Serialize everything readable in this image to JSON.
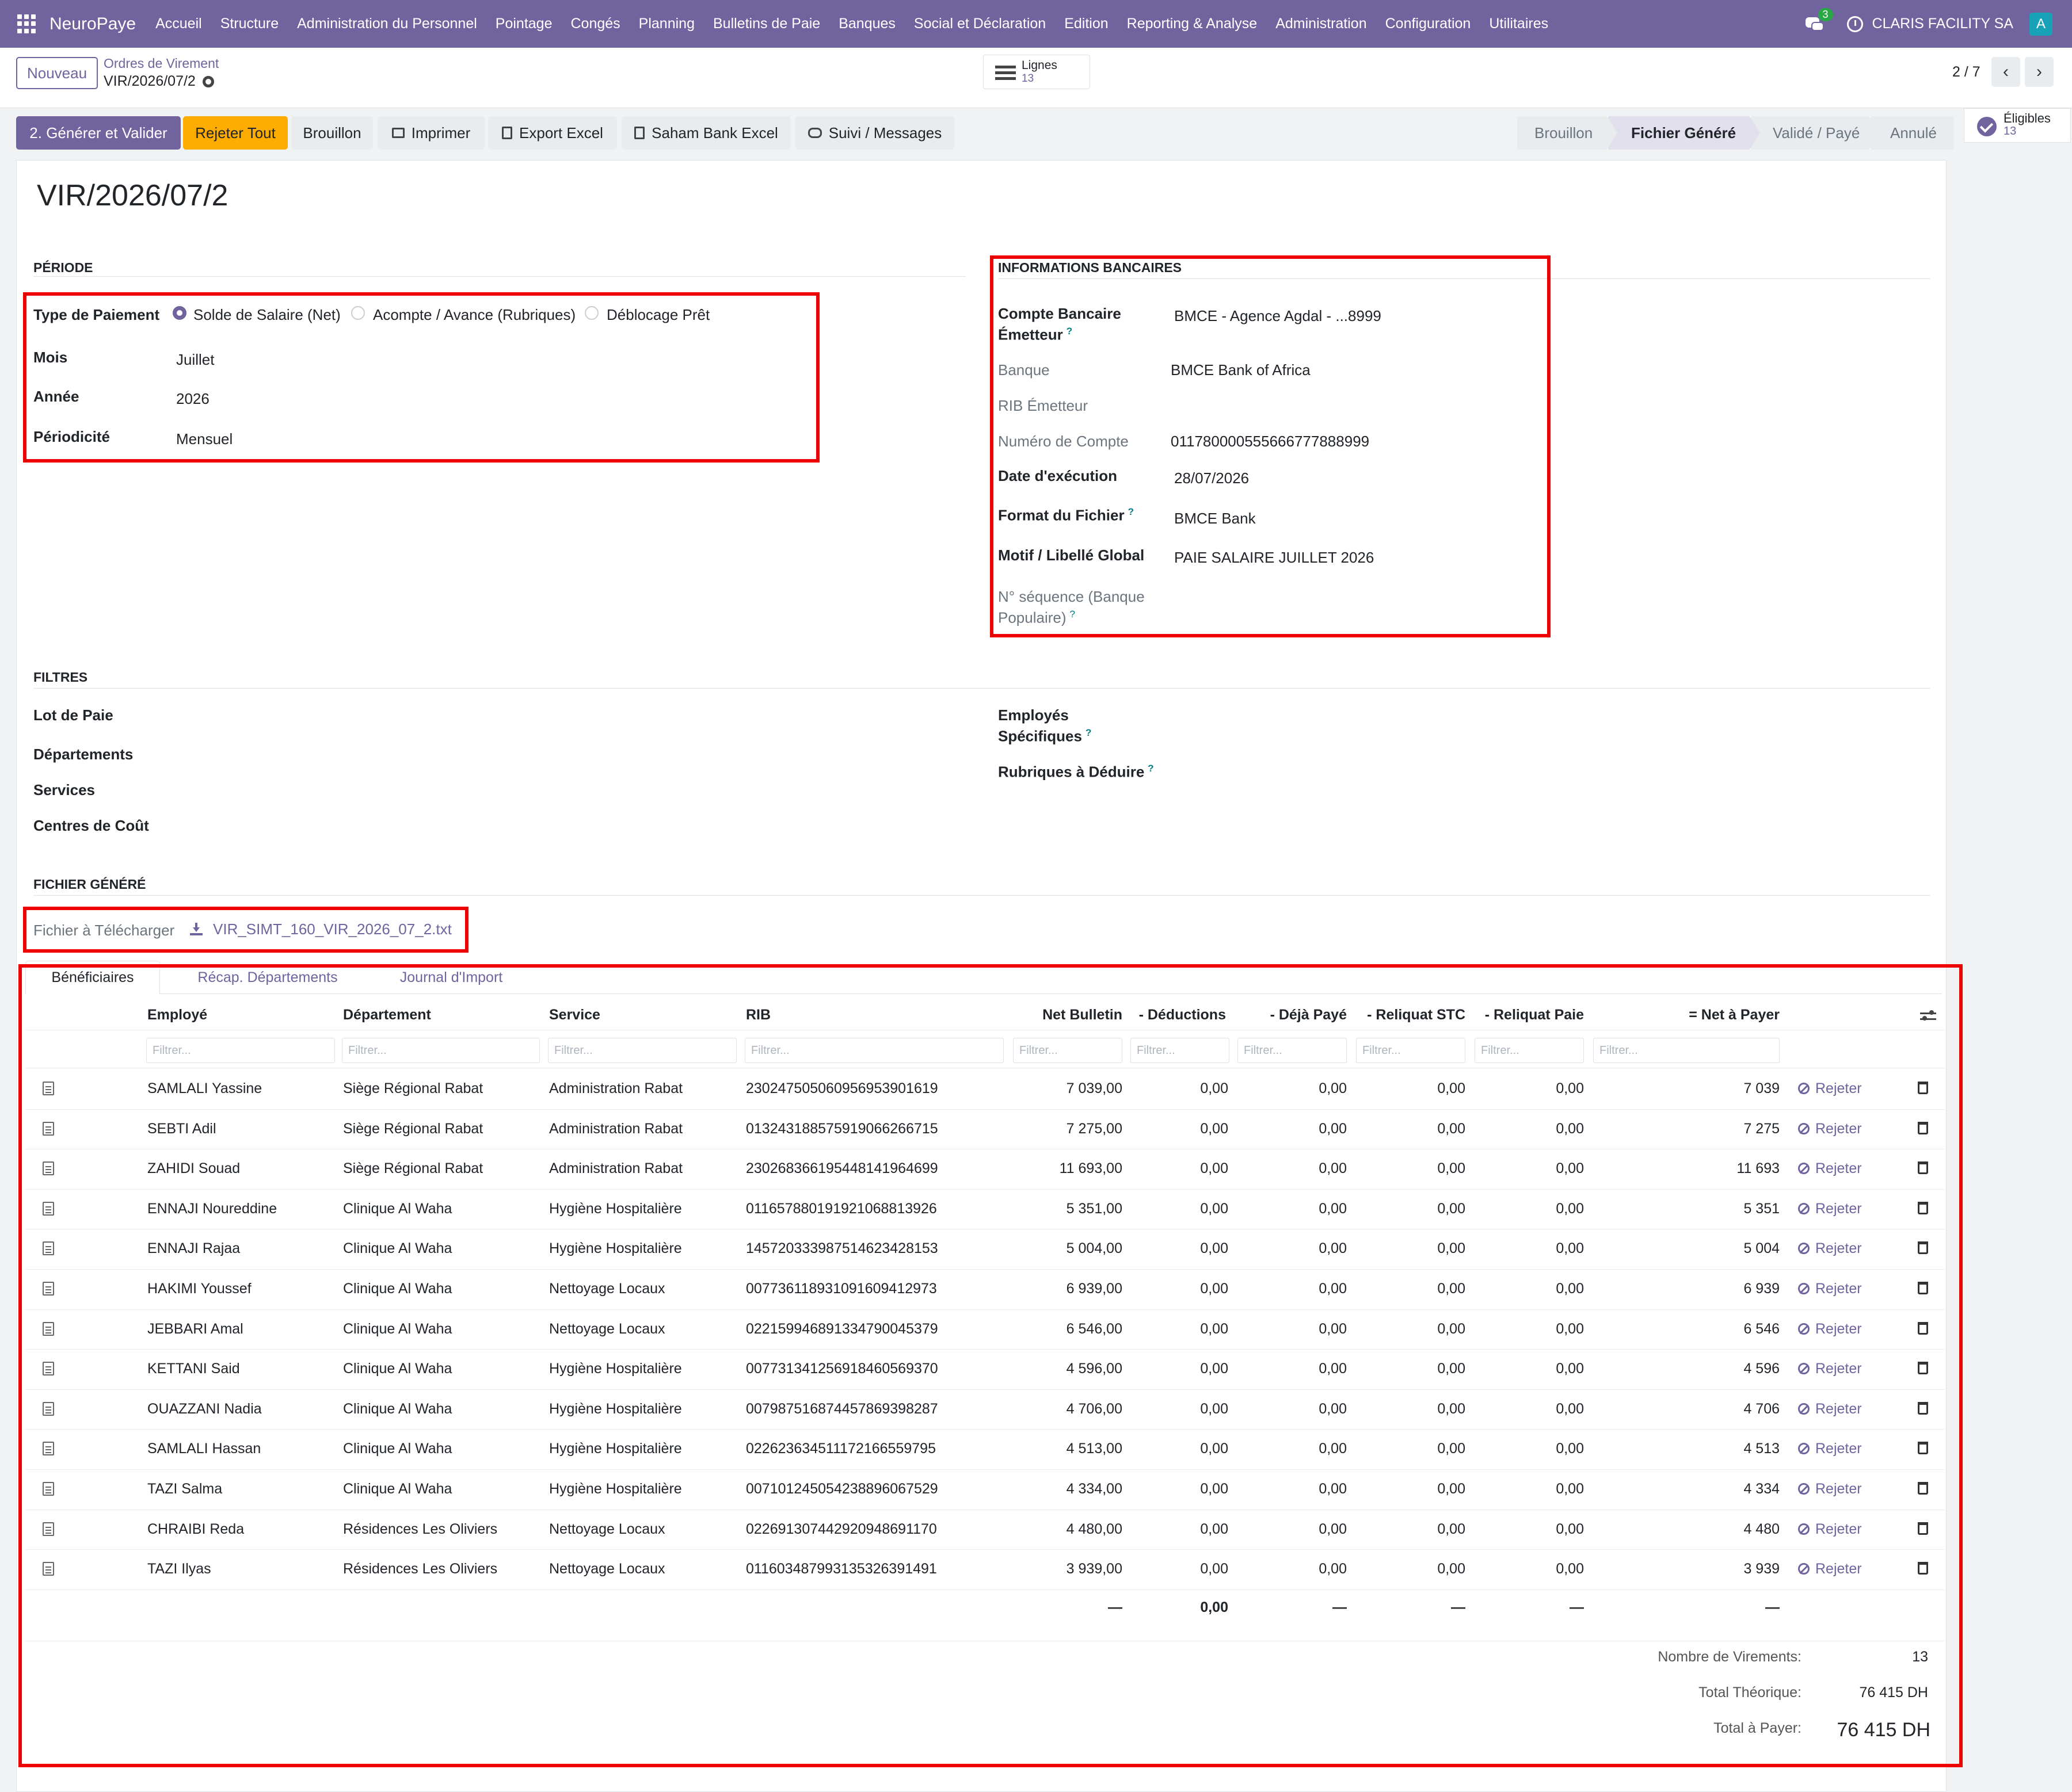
{
  "app": {
    "brand": "NeuroPaye",
    "menu": [
      "Accueil",
      "Structure",
      "Administration du Personnel",
      "Pointage",
      "Congés",
      "Planning",
      "Bulletins de Paie",
      "Banques",
      "Social et Déclaration",
      "Edition",
      "Reporting & Analyse",
      "Administration",
      "Configuration",
      "Utilitaires"
    ],
    "chat_badge": "3",
    "company": "CLARIS FACILITY SA",
    "avatar": "A"
  },
  "control": {
    "new_button": "Nouveau",
    "breadcrumb_parent": "Ordres de Virement",
    "breadcrumb_current": "VIR/2026/07/2",
    "lines_label": "Lignes",
    "lines_count": "13",
    "pager": "2 / 7"
  },
  "actions": {
    "generate": "2. Générer et Valider",
    "reject_all": "Rejeter Tout",
    "draft": "Brouillon",
    "print": "Imprimer",
    "export_excel": "Export Excel",
    "saham": "Saham Bank Excel",
    "followup": "Suivi / Messages"
  },
  "status": {
    "stages": [
      "Brouillon",
      "Fichier Généré",
      "Validé / Payé",
      "Annulé"
    ],
    "active": "Fichier Généré"
  },
  "side": {
    "label": "Éligibles",
    "count": "13"
  },
  "record": {
    "title": "VIR/2026/07/2",
    "periode": {
      "section": "PÉRIODE",
      "type_label": "Type de Paiement",
      "type_options": [
        "Solde de Salaire (Net)",
        "Acompte / Avance (Rubriques)",
        "Déblocage Prêt"
      ],
      "type_selected": "Solde de Salaire (Net)",
      "mois_label": "Mois",
      "mois": "Juillet",
      "annee_label": "Année",
      "annee": "2026",
      "periodicite_label": "Périodicité",
      "periodicite": "Mensuel"
    },
    "bank": {
      "section": "INFORMATIONS BANCAIRES",
      "compte_label_1": "Compte Bancaire",
      "compte_label_2": "Émetteur",
      "compte": "BMCE - Agence Agdal - ...8999",
      "banque_label": "Banque",
      "banque": "BMCE Bank of Africa",
      "rib_label": "RIB Émetteur",
      "numero_label": "Numéro de Compte",
      "numero": "011780000555666777888999",
      "date_label": "Date d'exécution",
      "date": "28/07/2026",
      "format_label": "Format du Fichier",
      "format": "BMCE Bank",
      "motif_label": "Motif / Libellé Global",
      "motif": "PAIE SALAIRE JUILLET 2026",
      "sequence_label_1": "N° séquence (Banque",
      "sequence_label_2": "Populaire)"
    },
    "filtres": {
      "section": "FILTRES",
      "lot": "Lot de Paie",
      "departements": "Départements",
      "services": "Services",
      "centres": "Centres de Coût",
      "employes_1": "Employés",
      "employes_2": "Spécifiques",
      "rubriques": "Rubriques à Déduire"
    },
    "fichier": {
      "section": "FICHIER GÉNÉRÉ",
      "label": "Fichier à Télécharger",
      "filename": "VIR_SIMT_160_VIR_2026_07_2.txt"
    }
  },
  "tabs": [
    "Bénéficiaires",
    "Récap. Départements",
    "Journal d'Import"
  ],
  "table": {
    "headers": [
      "Employé",
      "Département",
      "Service",
      "RIB",
      "Net Bulletin",
      "- Déductions",
      "- Déjà Payé",
      "- Reliquat STC",
      "- Reliquat Paie",
      "= Net à Payer"
    ],
    "filter_placeholder": "Filtrer...",
    "reject_label": "Rejeter",
    "rows": [
      {
        "employe": "SAMLALI Yassine",
        "departement": "Siège Régional Rabat",
        "service": "Administration Rabat",
        "rib": "230247505060956953901619",
        "net": "7 039,00",
        "ded": "0,00",
        "paye": "0,00",
        "stc": "0,00",
        "paie": "0,00",
        "apayer": "7 039"
      },
      {
        "employe": "SEBTI Adil",
        "departement": "Siège Régional Rabat",
        "service": "Administration Rabat",
        "rib": "013243188575919066266715",
        "net": "7 275,00",
        "ded": "0,00",
        "paye": "0,00",
        "stc": "0,00",
        "paie": "0,00",
        "apayer": "7 275"
      },
      {
        "employe": "ZAHIDI Souad",
        "departement": "Siège Régional Rabat",
        "service": "Administration Rabat",
        "rib": "230268366195448141964699",
        "net": "11 693,00",
        "ded": "0,00",
        "paye": "0,00",
        "stc": "0,00",
        "paie": "0,00",
        "apayer": "11 693"
      },
      {
        "employe": "ENNAJI Noureddine",
        "departement": "Clinique Al Waha",
        "service": "Hygiène Hospitalière",
        "rib": "011657880191921068813926",
        "net": "5 351,00",
        "ded": "0,00",
        "paye": "0,00",
        "stc": "0,00",
        "paie": "0,00",
        "apayer": "5 351"
      },
      {
        "employe": "ENNAJI Rajaa",
        "departement": "Clinique Al Waha",
        "service": "Hygiène Hospitalière",
        "rib": "145720333987514623428153",
        "net": "5 004,00",
        "ded": "0,00",
        "paye": "0,00",
        "stc": "0,00",
        "paie": "0,00",
        "apayer": "5 004"
      },
      {
        "employe": "HAKIMI Youssef",
        "departement": "Clinique Al Waha",
        "service": "Nettoyage Locaux",
        "rib": "007736118931091609412973",
        "net": "6 939,00",
        "ded": "0,00",
        "paye": "0,00",
        "stc": "0,00",
        "paie": "0,00",
        "apayer": "6 939"
      },
      {
        "employe": "JEBBARI Amal",
        "departement": "Clinique Al Waha",
        "service": "Nettoyage Locaux",
        "rib": "022159946891334790045379",
        "net": "6 546,00",
        "ded": "0,00",
        "paye": "0,00",
        "stc": "0,00",
        "paie": "0,00",
        "apayer": "6 546"
      },
      {
        "employe": "KETTANI Said",
        "departement": "Clinique Al Waha",
        "service": "Hygiène Hospitalière",
        "rib": "007731341256918460569370",
        "net": "4 596,00",
        "ded": "0,00",
        "paye": "0,00",
        "stc": "0,00",
        "paie": "0,00",
        "apayer": "4 596"
      },
      {
        "employe": "OUAZZANI Nadia",
        "departement": "Clinique Al Waha",
        "service": "Hygiène Hospitalière",
        "rib": "007987516874457869398287",
        "net": "4 706,00",
        "ded": "0,00",
        "paye": "0,00",
        "stc": "0,00",
        "paie": "0,00",
        "apayer": "4 706"
      },
      {
        "employe": "SAMLALI Hassan",
        "departement": "Clinique Al Waha",
        "service": "Hygiène Hospitalière",
        "rib": "022623634511172166559795",
        "net": "4 513,00",
        "ded": "0,00",
        "paye": "0,00",
        "stc": "0,00",
        "paie": "0,00",
        "apayer": "4 513"
      },
      {
        "employe": "TAZI Salma",
        "departement": "Clinique Al Waha",
        "service": "Hygiène Hospitalière",
        "rib": "007101245054238896067529",
        "net": "4 334,00",
        "ded": "0,00",
        "paye": "0,00",
        "stc": "0,00",
        "paie": "0,00",
        "apayer": "4 334"
      },
      {
        "employe": "CHRAIBI Reda",
        "departement": "Résidences Les Oliviers",
        "service": "Nettoyage Locaux",
        "rib": "022691307442920948691170",
        "net": "4 480,00",
        "ded": "0,00",
        "paye": "0,00",
        "stc": "0,00",
        "paie": "0,00",
        "apayer": "4 480"
      },
      {
        "employe": "TAZI Ilyas",
        "departement": "Résidences Les Oliviers",
        "service": "Nettoyage Locaux",
        "rib": "011603487993135326391491",
        "net": "3 939,00",
        "ded": "0,00",
        "paye": "0,00",
        "stc": "0,00",
        "paie": "0,00",
        "apayer": "3 939"
      }
    ],
    "totals": {
      "net": "—",
      "ded": "0,00",
      "paye": "—",
      "stc": "—",
      "paie": "—",
      "apayer": "—"
    }
  },
  "summary": {
    "nb_label": "Nombre de Virements:",
    "nb": "13",
    "theorique_label": "Total Théorique:",
    "theorique": "76 415 DH",
    "payer_label": "Total à Payer:",
    "payer": "76 415 DH"
  },
  "colors": {
    "primary": "#71639e",
    "warning": "#ffac00",
    "highlight": "#e00000"
  }
}
